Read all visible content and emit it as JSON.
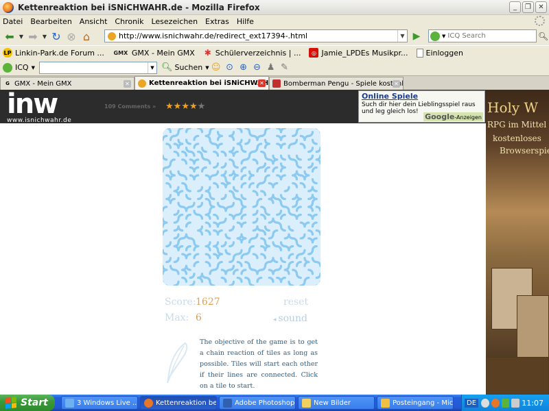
{
  "window": {
    "title": "Kettenreaktion bei iSNiCHWAHR.de - Mozilla Firefox"
  },
  "menu": [
    "Datei",
    "Bearbeiten",
    "Ansicht",
    "Chronik",
    "Lesezeichen",
    "Extras",
    "Hilfe"
  ],
  "nav": {
    "url": "http://www.isnichwahr.de/redirect_ext17394-.html",
    "search_placeholder": "ICQ Search"
  },
  "bookmarks": [
    {
      "label": "Linkin-Park.de Forum ...",
      "icon": "linkin-park-icon"
    },
    {
      "label": "GMX - Mein GMX",
      "icon": "gmx-icon"
    },
    {
      "label": "Schülerverzeichnis | ...",
      "icon": "star-icon"
    },
    {
      "label": "Jamie_LPDEs Musikpr...",
      "icon": "lastfm-icon"
    },
    {
      "label": "Einloggen",
      "icon": "page-icon"
    }
  ],
  "icqbar": {
    "label": "ICQ",
    "search_label": "Suchen"
  },
  "tabs": [
    {
      "label": "GMX - Mein GMX",
      "active": false
    },
    {
      "label": "Kettenreaktion bei iSNiCHWAHR.de",
      "active": true
    },
    {
      "label": "Bomberman Pengu - Spiele kostenlose ...",
      "active": false
    }
  ],
  "site": {
    "logo_text": "inw",
    "logo_url": "www.isnichwahr.de",
    "comments": "109 Comments »",
    "rating": 4,
    "rating_max": 5
  },
  "ad": {
    "title": "Online Spiele",
    "text": "Such dir hier dein Lieblingsspiel raus und leg gleich los!",
    "footer_brand": "Google",
    "footer_text": "-Anzeigen"
  },
  "banner": {
    "line1": "Holy W",
    "line2": "RPG im Mittel",
    "line3": "kostenloses",
    "line4": "Browserspie"
  },
  "game": {
    "score_label": "Score:",
    "score": "1627",
    "max_label": "Max:",
    "max": "6",
    "reset_label": "reset",
    "sound_label": "sound",
    "description": "The objective of the game is to get a chain reaction of tiles as long as possible. Tiles will start each other if their lines are connected. Click on a tile to start.",
    "colors": {
      "tile": "#8ccaf0",
      "board": "#dbeefb",
      "score": "#e0a050",
      "muted": "#c9dbe9",
      "text": "#2b5f88"
    }
  },
  "taskbar": {
    "start_label": "Start",
    "tasks": [
      {
        "label": "3 Windows Live ...",
        "active": false,
        "color": "#6fb0f0"
      },
      {
        "label": "Kettenreaktion bei ...",
        "active": true,
        "color": "#e8762a"
      },
      {
        "label": "Adobe Photoshop ...",
        "active": false,
        "color": "#3160b0"
      },
      {
        "label": "New Bilder",
        "active": false,
        "color": "#f0d060"
      },
      {
        "label": "Posteingang - Micr...",
        "active": false,
        "color": "#f0c040"
      }
    ],
    "lang": "DE",
    "clock": "11:07"
  }
}
